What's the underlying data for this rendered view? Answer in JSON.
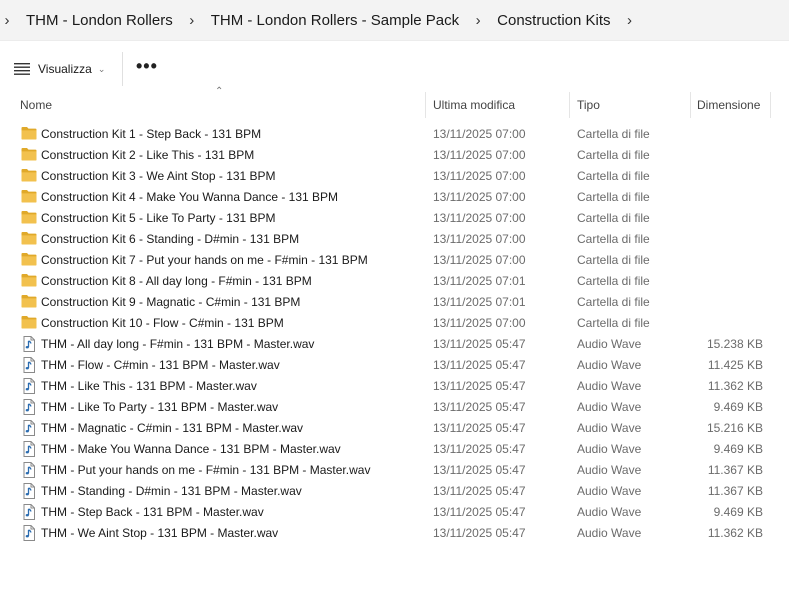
{
  "breadcrumbs": [
    "THM - London Rollers",
    "THM - London Rollers - Sample Pack",
    "Construction Kits"
  ],
  "toolbar": {
    "view_label": "Visualizza",
    "more_label": "•••"
  },
  "columns": {
    "name": "Nome",
    "modified": "Ultima modifica",
    "type": "Tipo",
    "size": "Dimensione"
  },
  "files": [
    {
      "name": "Construction Kit 1 - Step Back - 131 BPM",
      "modified": "13/11/2025 07:00",
      "type": "Cartella di file",
      "size": "",
      "icon": "folder-icon"
    },
    {
      "name": "Construction Kit 2 - Like This - 131 BPM",
      "modified": "13/11/2025 07:00",
      "type": "Cartella di file",
      "size": "",
      "icon": "folder-icon"
    },
    {
      "name": "Construction Kit 3 - We Aint Stop - 131 BPM",
      "modified": "13/11/2025 07:00",
      "type": "Cartella di file",
      "size": "",
      "icon": "folder-icon"
    },
    {
      "name": "Construction Kit 4 - Make You Wanna Dance - 131 BPM",
      "modified": "13/11/2025 07:00",
      "type": "Cartella di file",
      "size": "",
      "icon": "folder-icon"
    },
    {
      "name": "Construction Kit 5 - Like To Party - 131 BPM",
      "modified": "13/11/2025 07:00",
      "type": "Cartella di file",
      "size": "",
      "icon": "folder-icon"
    },
    {
      "name": "Construction Kit 6 - Standing - D#min - 131 BPM",
      "modified": "13/11/2025 07:00",
      "type": "Cartella di file",
      "size": "",
      "icon": "folder-icon"
    },
    {
      "name": "Construction Kit 7 - Put your hands on me - F#min - 131 BPM",
      "modified": "13/11/2025 07:00",
      "type": "Cartella di file",
      "size": "",
      "icon": "folder-icon"
    },
    {
      "name": "Construction Kit 8 - All day long - F#min - 131 BPM",
      "modified": "13/11/2025 07:01",
      "type": "Cartella di file",
      "size": "",
      "icon": "folder-icon"
    },
    {
      "name": "Construction Kit 9 - Magnatic - C#min - 131 BPM",
      "modified": "13/11/2025 07:01",
      "type": "Cartella di file",
      "size": "",
      "icon": "folder-icon"
    },
    {
      "name": "Construction Kit 10 - Flow - C#min - 131 BPM",
      "modified": "13/11/2025 07:00",
      "type": "Cartella di file",
      "size": "",
      "icon": "folder-icon"
    },
    {
      "name": "THM - All day long - F#min - 131 BPM - Master.wav",
      "modified": "13/11/2025 05:47",
      "type": "Audio Wave",
      "size": "15.238 KB",
      "icon": "audio-file-icon"
    },
    {
      "name": "THM - Flow - C#min - 131 BPM - Master.wav",
      "modified": "13/11/2025 05:47",
      "type": "Audio Wave",
      "size": "11.425 KB",
      "icon": "audio-file-icon"
    },
    {
      "name": "THM - Like This - 131 BPM - Master.wav",
      "modified": "13/11/2025 05:47",
      "type": "Audio Wave",
      "size": "11.362 KB",
      "icon": "audio-file-icon"
    },
    {
      "name": "THM - Like To Party - 131 BPM - Master.wav",
      "modified": "13/11/2025 05:47",
      "type": "Audio Wave",
      "size": "9.469 KB",
      "icon": "audio-file-icon"
    },
    {
      "name": "THM - Magnatic - C#min - 131 BPM - Master.wav",
      "modified": "13/11/2025 05:47",
      "type": "Audio Wave",
      "size": "15.216 KB",
      "icon": "audio-file-icon"
    },
    {
      "name": "THM - Make You Wanna Dance - 131 BPM - Master.wav",
      "modified": "13/11/2025 05:47",
      "type": "Audio Wave",
      "size": "9.469 KB",
      "icon": "audio-file-icon"
    },
    {
      "name": "THM - Put your hands on me - F#min - 131 BPM - Master.wav",
      "modified": "13/11/2025 05:47",
      "type": "Audio Wave",
      "size": "11.367 KB",
      "icon": "audio-file-icon"
    },
    {
      "name": "THM - Standing - D#min - 131 BPM - Master.wav",
      "modified": "13/11/2025 05:47",
      "type": "Audio Wave",
      "size": "11.367 KB",
      "icon": "audio-file-icon"
    },
    {
      "name": "THM - Step Back - 131 BPM - Master.wav",
      "modified": "13/11/2025 05:47",
      "type": "Audio Wave",
      "size": "9.469 KB",
      "icon": "audio-file-icon"
    },
    {
      "name": "THM - We Aint Stop - 131 BPM - Master.wav",
      "modified": "13/11/2025 05:47",
      "type": "Audio Wave",
      "size": "11.362 KB",
      "icon": "audio-file-icon"
    }
  ],
  "colors": {
    "folder": "#f2c14e",
    "folder_dark": "#e0a92a",
    "audio_note": "#2b6cb0"
  }
}
